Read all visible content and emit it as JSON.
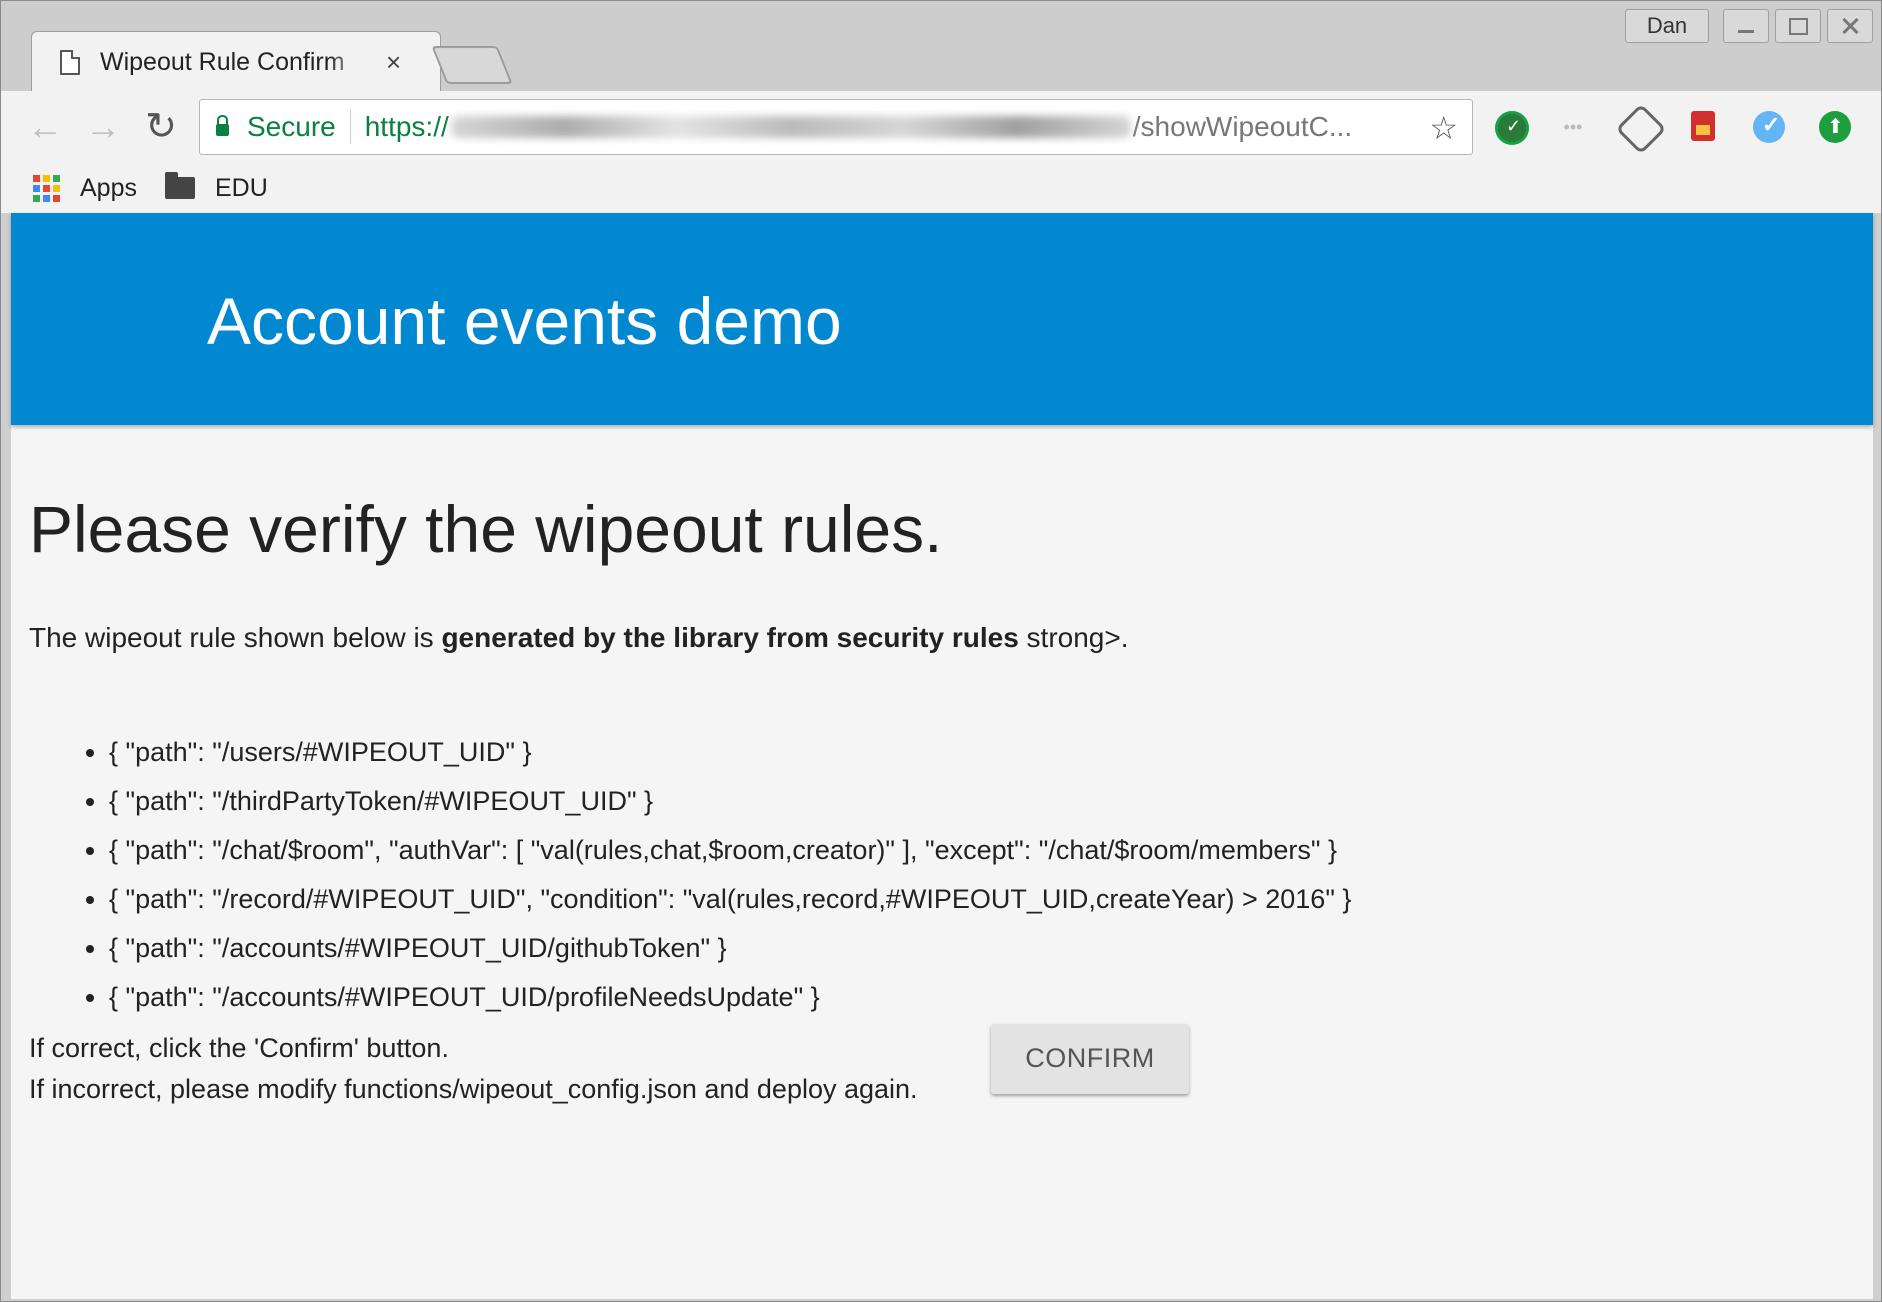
{
  "browser": {
    "tab_title": "Wipeout Rule Confirm",
    "tab_close": "×",
    "profile_name": "Dan",
    "security_label": "Secure",
    "url_scheme": "https://",
    "url_tail": "/showWipeoutC...",
    "bookmarks": [
      {
        "label": "Apps",
        "icon": "apps-grid-icon"
      },
      {
        "label": "EDU",
        "icon": "folder-icon"
      }
    ],
    "extensions": [
      "extension-check-icon",
      "extension-dots-icon",
      "extension-tag-icon",
      "extension-sd-icon",
      "extension-blue-check-icon",
      "extension-upload-icon"
    ]
  },
  "header": {
    "title": "Account events demo",
    "background": "#0288d1"
  },
  "main": {
    "heading": "Please verify the wipeout rules.",
    "intro_prefix": "The wipeout rule shown below is ",
    "intro_bold": "generated by the library from security rules",
    "intro_suffix": " strong>.",
    "rules": [
      "{ \"path\": \"/users/#WIPEOUT_UID\" }",
      "{ \"path\": \"/thirdPartyToken/#WIPEOUT_UID\" }",
      "{ \"path\": \"/chat/$room\", \"authVar\": [ \"val(rules,chat,$room,creator)\" ], \"except\": \"/chat/$room/members\" }",
      "{ \"path\": \"/record/#WIPEOUT_UID\", \"condition\": \"val(rules,record,#WIPEOUT_UID,createYear) > 2016\" }",
      "{ \"path\": \"/accounts/#WIPEOUT_UID/githubToken\" }",
      "{ \"path\": \"/accounts/#WIPEOUT_UID/profileNeedsUpdate\" }"
    ],
    "confirm_line1": "If correct, click the 'Confirm' button.",
    "confirm_line2": "If incorrect, please modify functions/wipeout_config.json and deploy again.",
    "confirm_button": "CONFIRM"
  }
}
